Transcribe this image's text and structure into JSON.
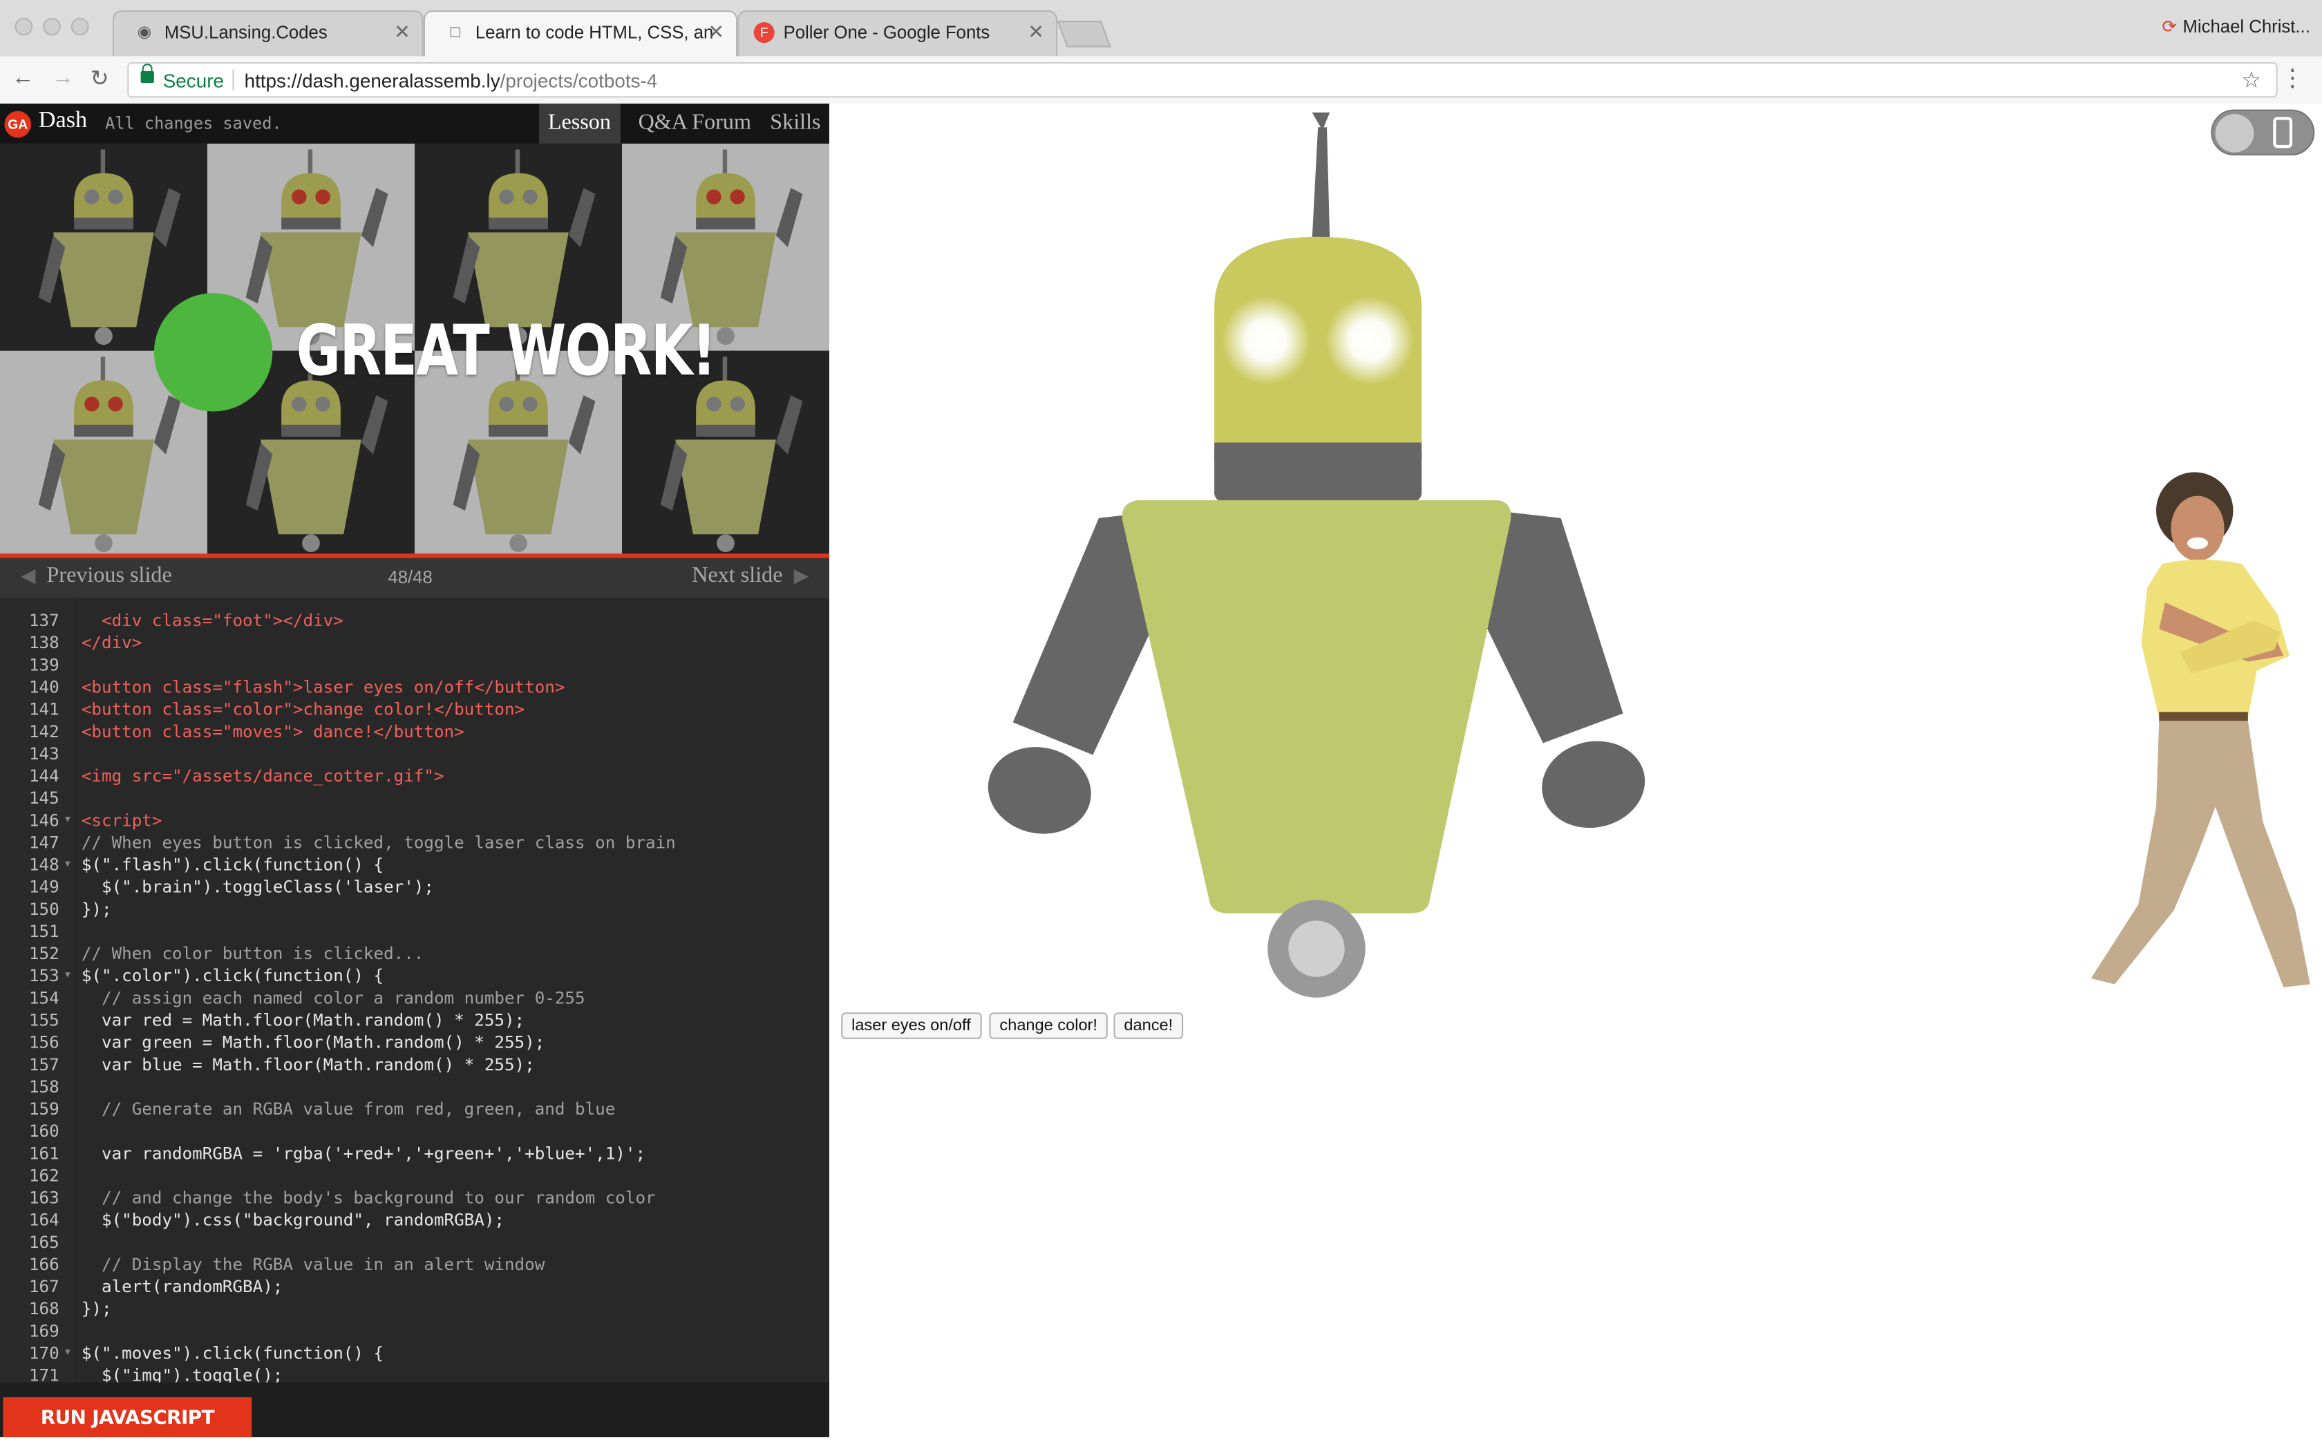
{
  "browser": {
    "tabs": [
      {
        "title": "MSU.Lansing.Codes",
        "icon": "code-icon",
        "active": false
      },
      {
        "title": "Learn to code HTML, CSS, and",
        "icon": "page-icon",
        "active": true
      },
      {
        "title": "Poller One - Google Fonts",
        "icon": "fonts-icon",
        "active": false
      }
    ],
    "user": "Michael Christ...",
    "secure_label": "Secure",
    "url_host": "https://dash.generalassemb.ly",
    "url_path": "/projects/cotbots-4"
  },
  "dash": {
    "logo": "GA",
    "app_name": "Dash",
    "status": "All changes saved.",
    "tabs": [
      "Lesson",
      "Q&A Forum",
      "Skills"
    ],
    "active_tab": "Lesson",
    "slide_text": "GREAT WORK!",
    "prev_label": "Previous slide",
    "next_label": "Next slide",
    "slide_counter": "48/48",
    "run_button": "RUN JAVASCRIPT"
  },
  "code": {
    "lines": [
      {
        "n": "137",
        "t": "  <div class=\"foot\"></div>"
      },
      {
        "n": "138",
        "t": "</div>"
      },
      {
        "n": "139",
        "t": ""
      },
      {
        "n": "140",
        "t": "<button class=\"flash\">laser eyes on/off</button>"
      },
      {
        "n": "141",
        "t": "<button class=\"color\">change color!</button>"
      },
      {
        "n": "142",
        "t": "<button class=\"moves\"> dance!</button>"
      },
      {
        "n": "143",
        "t": ""
      },
      {
        "n": "144",
        "t": "<img src=\"/assets/dance_cotter.gif\">"
      },
      {
        "n": "145",
        "t": ""
      },
      {
        "n": "146",
        "t": "<script>",
        "fold": true
      },
      {
        "n": "147",
        "t": "// When eyes button is clicked, toggle laser class on brain"
      },
      {
        "n": "148",
        "t": "$(\".flash\").click(function() {",
        "fold": true
      },
      {
        "n": "149",
        "t": "  $(\".brain\").toggleClass('laser');"
      },
      {
        "n": "150",
        "t": "});"
      },
      {
        "n": "151",
        "t": ""
      },
      {
        "n": "152",
        "t": "// When color button is clicked..."
      },
      {
        "n": "153",
        "t": "$(\".color\").click(function() {",
        "fold": true
      },
      {
        "n": "154",
        "t": "  // assign each named color a random number 0-255"
      },
      {
        "n": "155",
        "t": "  var red = Math.floor(Math.random() * 255);"
      },
      {
        "n": "156",
        "t": "  var green = Math.floor(Math.random() * 255);"
      },
      {
        "n": "157",
        "t": "  var blue = Math.floor(Math.random() * 255);"
      },
      {
        "n": "158",
        "t": ""
      },
      {
        "n": "159",
        "t": "  // Generate an RGBA value from red, green, and blue"
      },
      {
        "n": "160",
        "t": ""
      },
      {
        "n": "161",
        "t": "  var randomRGBA = 'rgba('+red+','+green+','+blue+',1)';"
      },
      {
        "n": "162",
        "t": ""
      },
      {
        "n": "163",
        "t": "  // and change the body's background to our random color"
      },
      {
        "n": "164",
        "t": "  $(\"body\").css(\"background\", randomRGBA);"
      },
      {
        "n": "165",
        "t": ""
      },
      {
        "n": "166",
        "t": "  // Display the RGBA value in an alert window"
      },
      {
        "n": "167",
        "t": "  alert(randomRGBA);"
      },
      {
        "n": "168",
        "t": "});"
      },
      {
        "n": "169",
        "t": ""
      },
      {
        "n": "170",
        "t": "$(\".moves\").click(function() {",
        "fold": true
      },
      {
        "n": "171",
        "t": "  $(\"img\").toggle();"
      }
    ]
  },
  "preview": {
    "buttons": [
      "laser eyes on/off",
      "change color!",
      "dance!"
    ],
    "robot_colors": {
      "head": "#c9c95e",
      "body": "#bdc96c",
      "limbs": "#666666",
      "wheel": "#999999"
    }
  },
  "colors": {
    "accent": "#e2331b",
    "success": "#4cb63f",
    "secure": "#0b8043"
  }
}
